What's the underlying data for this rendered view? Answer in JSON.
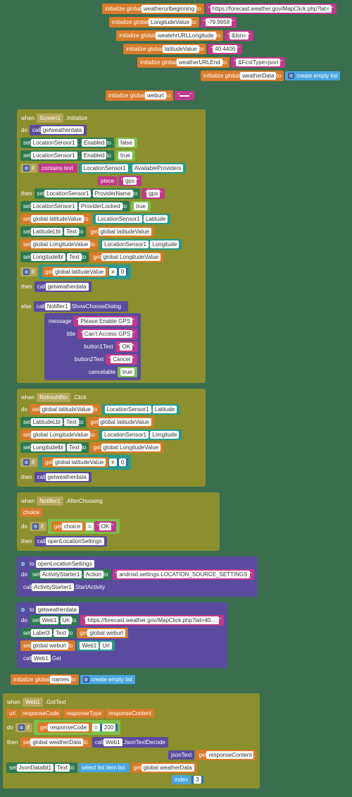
{
  "init": {
    "g1_label": "initialize global",
    "g1_name": "weatherurlbeginning",
    "g1_to": "to",
    "g1_val": "https://forecast.weather.gov/MapClick.php?lat=",
    "g2_name": "LongitudeValue",
    "g2_val": "-79.9958",
    "g3_name": "weatehrURLLongitude",
    "g3_val": "&lon=",
    "g4_name": "latitudeValue",
    "g4_val": "40.4406",
    "g5_name": "weatherURLEnd",
    "g5_val": "&FcstType=json",
    "g6_name": "weatherData",
    "g6_to": "to",
    "g6_create": "create empty list",
    "g7_name": "weburl",
    "g7_val": "",
    "g8_name": "names"
  },
  "screen1": {
    "when": "when",
    "who": "Screen1",
    "evt": ".Initialize",
    "do": "do",
    "call": "call",
    "get": "getweatherdata",
    "set": "set",
    "loc": "LocationSensor1",
    "enabled": ".Enabled",
    "to": "to",
    "false": "false",
    "true": "true",
    "if": "if",
    "contains": "contains",
    "text": "text",
    "avail": ".AvailableProviders",
    "piece": "piece",
    "gps": "gps",
    "then": "then",
    "provname": ".ProviderName",
    "provlock": ".ProviderLocked",
    "glat": "global latitudeValue",
    "glon": "global LongitudeValue",
    "lat": ".Latitude",
    "lon": ".Longitude",
    "latlbl": "LatitudeLbl",
    "lonlbl": "Longitudelbl",
    "txtprop": ".Text",
    "getkw": "get",
    "neq": "≠",
    "zero": "0",
    "else": "else",
    "notif": "Notifier1",
    "showdlg": ".ShowChooseDialog",
    "message": "message",
    "title": "title",
    "b1": "button1Text",
    "b2": "button2Text",
    "cancel": "cancelable",
    "msg_v": "Please Enable GPS",
    "title_v": "Can't Access GPS",
    "ok": "OK",
    "cancel_v": "Cancel"
  },
  "refresh": {
    "when": "when",
    "who": "RefreshBtn",
    "evt": ".Click"
  },
  "afterchoose": {
    "when": "when",
    "who": "Notifier1",
    "evt": ".AfterChoosing",
    "choice": "choice",
    "get": "get",
    "eq": "=",
    "ok": "OK",
    "openloc": "openLocationSettings"
  },
  "openloc": {
    "to": "to",
    "name": "openLocationSettings",
    "do": "do",
    "set": "set",
    "act": "ActivityStarter1",
    "action": ".Action",
    "val": "android.settings.LOCATION_SOURCE_SETTINGS",
    "call": "call",
    "start": ".StartActivity"
  },
  "getweather": {
    "to": "to",
    "name": "getweatherdata",
    "do": "do",
    "set": "set",
    "web": "Web1",
    "url": ".Url",
    "urlval": "https://forecast.weather.gov/MapClick.php?lat=40....",
    "lbl3": "Label3",
    "txt": ".Text",
    "getkw": "get",
    "gweb": "global weburl",
    "call": "call",
    "getm": ".Get"
  },
  "gottext": {
    "when": "when",
    "who": "Web1",
    "evt": ".GotText",
    "url": "url",
    "rc": "responseCode",
    "rt": "responseType",
    "rcont": "responseContent",
    "do": "do",
    "if": "if",
    "get": "get",
    "eq": "=",
    "v200": "200",
    "then": "then",
    "set": "set",
    "gwd": "global weatherData",
    "to": "to",
    "call": "call",
    "json": ".JsonTextDecode",
    "jt": "jsonText",
    "jlbl": "JsonDatalbl1",
    "txt": ".Text",
    "sel": "select list item",
    "list": "list",
    "index": "index",
    "idx": "3"
  }
}
